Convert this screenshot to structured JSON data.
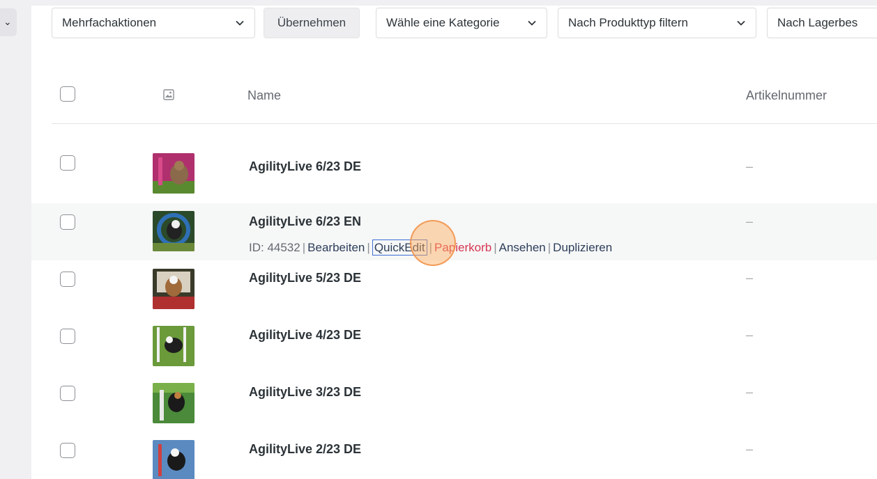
{
  "sidebar_stub": {
    "glyph": "⌄"
  },
  "toolbar": {
    "bulk_actions": {
      "value": "Mehrfachaktionen"
    },
    "apply_label": "Übernehmen",
    "category_filter": {
      "value": "Wähle eine Kategorie"
    },
    "product_type_filter": {
      "value": "Nach Produkttyp filtern"
    },
    "stock_filter": {
      "value": "Nach Lagerbes"
    }
  },
  "table": {
    "columns": {
      "name": "Name",
      "sku": "Artikelnummer"
    },
    "rows": [
      {
        "name": "AgilityLive 6/23 DE",
        "sku": "–"
      },
      {
        "name": "AgilityLive 6/23 EN",
        "sku": "–"
      },
      {
        "name": "AgilityLive 5/23 DE",
        "sku": "–"
      },
      {
        "name": "AgilityLive 4/23 DE",
        "sku": "–"
      },
      {
        "name": "AgilityLive 3/23 DE",
        "sku": "–"
      },
      {
        "name": "AgilityLive 2/23 DE",
        "sku": "–"
      }
    ],
    "row_actions": {
      "id_text": "ID: 44532",
      "edit": "Bearbeiten",
      "quickedit": "QuickEdit",
      "trash": "Papierkorb",
      "view": "Ansehen",
      "duplicate": "Duplizieren",
      "separator": "|"
    }
  },
  "colors": {
    "accent_link": "#2c3e5a",
    "trash_link": "#d63651",
    "highlight_border": "#3e6fd6",
    "click_marker": "#f0914a"
  }
}
